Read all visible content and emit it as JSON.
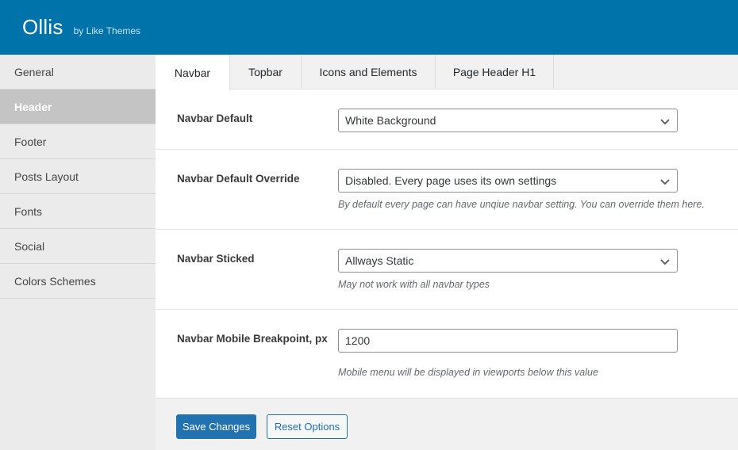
{
  "header": {
    "title": "Ollis",
    "subtitle": "by Like Themes"
  },
  "sidebar": {
    "items": [
      {
        "label": "General",
        "active": false
      },
      {
        "label": "Header",
        "active": true
      },
      {
        "label": "Footer",
        "active": false
      },
      {
        "label": "Posts Layout",
        "active": false
      },
      {
        "label": "Fonts",
        "active": false
      },
      {
        "label": "Social",
        "active": false
      },
      {
        "label": "Colors Schemes",
        "active": false
      }
    ]
  },
  "tabs": [
    {
      "label": "Navbar",
      "active": true
    },
    {
      "label": "Topbar",
      "active": false
    },
    {
      "label": "Icons and Elements",
      "active": false
    },
    {
      "label": "Page Header H1",
      "active": false
    }
  ],
  "fields": [
    {
      "label": "Navbar Default",
      "type": "select",
      "value": "White Background",
      "description": ""
    },
    {
      "label": "Navbar Default Override",
      "type": "select",
      "value": "Disabled. Every page uses its own settings",
      "description": "By default every page can have unqiue navbar setting. You can override them here."
    },
    {
      "label": "Navbar Sticked",
      "type": "select",
      "value": "Allways Static",
      "description": "May not work with all navbar types"
    },
    {
      "label": "Navbar Mobile Breakpoint, px",
      "type": "text",
      "value": "1200",
      "description": "Mobile menu will be displayed in viewports below this value"
    }
  ],
  "buttons": {
    "save": "Save Changes",
    "reset": "Reset Options"
  },
  "colors": {
    "brand": "#0073aa",
    "primary_button": "#2271b1"
  }
}
